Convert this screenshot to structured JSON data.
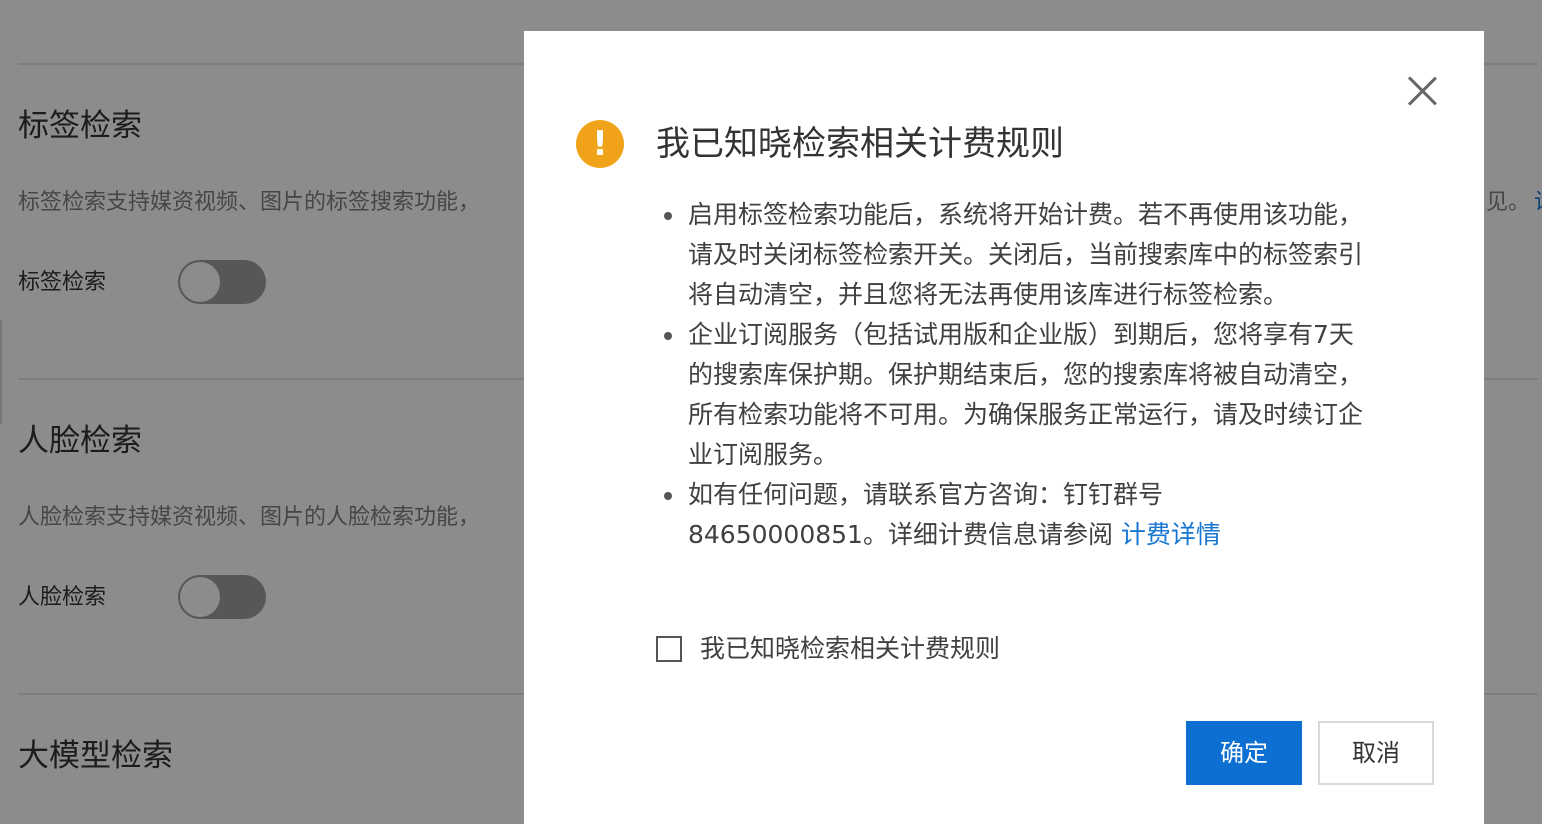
{
  "background": {
    "sections": [
      {
        "title": "标签检索",
        "description": "标签检索支持媒资视频、图片的标签搜索功能，",
        "toggle_label": "标签检索"
      },
      {
        "title": "人脸检索",
        "description": "人脸检索支持媒资视频、图片的人脸检索功能，",
        "toggle_label": "人脸检索"
      },
      {
        "title": "大模型检索"
      }
    ],
    "peek_text": "见。",
    "peek_link": "诊"
  },
  "dialog": {
    "icon": "warning-exclamation-icon",
    "icon_glyph": "!",
    "title": "我已知晓检索相关计费规则",
    "items": [
      {
        "text": "启用标签检索功能后，系统将开始计费。若不再使用该功能，请及时关闭标签检索开关。关闭后，当前搜索库中的标签索引将自动清空，并且您将无法再使用该库进行标签检索。"
      },
      {
        "text": "企业订阅服务（包括试用版和企业版）到期后，您将享有7天的搜索库保护期。保护期结束后，您的搜索库将被自动清空，所有检索功能将不可用。为确保服务正常运行，请及时续订企业订阅服务。"
      },
      {
        "text": "如有任何问题，请联系官方咨询：钉钉群号 84650000851。详细计费信息请参阅 ",
        "link": "计费详情"
      }
    ],
    "checkbox_label": "我已知晓检索相关计费规则",
    "checkbox_checked": false,
    "confirm_label": "确定",
    "cancel_label": "取消",
    "colors": {
      "primary": "#0c6fd1",
      "warning": "#f0a21a",
      "link": "#1677d2"
    }
  }
}
